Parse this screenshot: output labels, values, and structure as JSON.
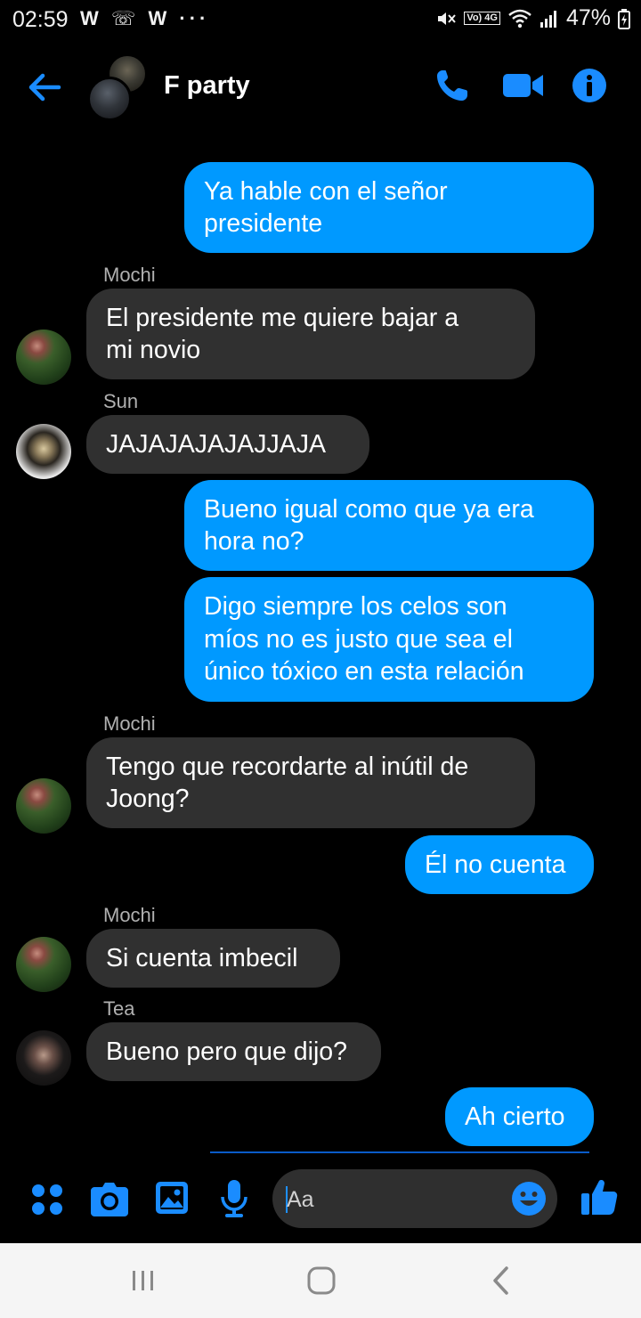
{
  "status_bar": {
    "time": "02:59",
    "left_icons": "W ☏ W ···",
    "network_badge": "Vo) 4G",
    "battery": "47%"
  },
  "header": {
    "title": "F party",
    "icons": [
      "back-arrow-icon",
      "phone-icon",
      "video-camera-icon",
      "info-icon"
    ]
  },
  "messages": [
    {
      "direction": "outgoing",
      "lines": [
        "Ya hable con el señor",
        "presidente"
      ]
    },
    {
      "direction": "incoming",
      "sender": "Mochi",
      "lines": [
        "El presidente me quiere bajar a",
        "mi novio"
      ]
    },
    {
      "direction": "incoming",
      "sender": "Sun",
      "lines": [
        "JAJAJAJAJAJJAJA"
      ]
    },
    {
      "direction": "outgoing",
      "lines": [
        "Bueno igual como que ya era",
        "hora no?"
      ]
    },
    {
      "direction": "outgoing",
      "lines": [
        "Digo siempre los celos son",
        "míos no es justo que sea el",
        "único tóxico en esta relación"
      ]
    },
    {
      "direction": "incoming",
      "sender": "Mochi",
      "lines": [
        "Tengo que recordarte al inútil de",
        "Joong?"
      ]
    },
    {
      "direction": "outgoing",
      "lines": [
        "Él no cuenta"
      ]
    },
    {
      "direction": "incoming",
      "sender": "Mochi",
      "lines": [
        "Si cuenta imbecil"
      ]
    },
    {
      "direction": "incoming",
      "sender": "Tea",
      "lines": [
        "Bueno pero que dijo?"
      ]
    },
    {
      "direction": "outgoing",
      "lines": [
        "Ah cierto"
      ]
    }
  ],
  "composer": {
    "placeholder": "Aa",
    "icons": [
      "menu-dots-icon",
      "camera-icon",
      "gallery-icon",
      "microphone-icon",
      "emoji-icon",
      "thumbs-up-icon"
    ]
  },
  "colors": {
    "accent": "#0099ff",
    "incoming_bubble": "#303030",
    "background": "#000000"
  }
}
